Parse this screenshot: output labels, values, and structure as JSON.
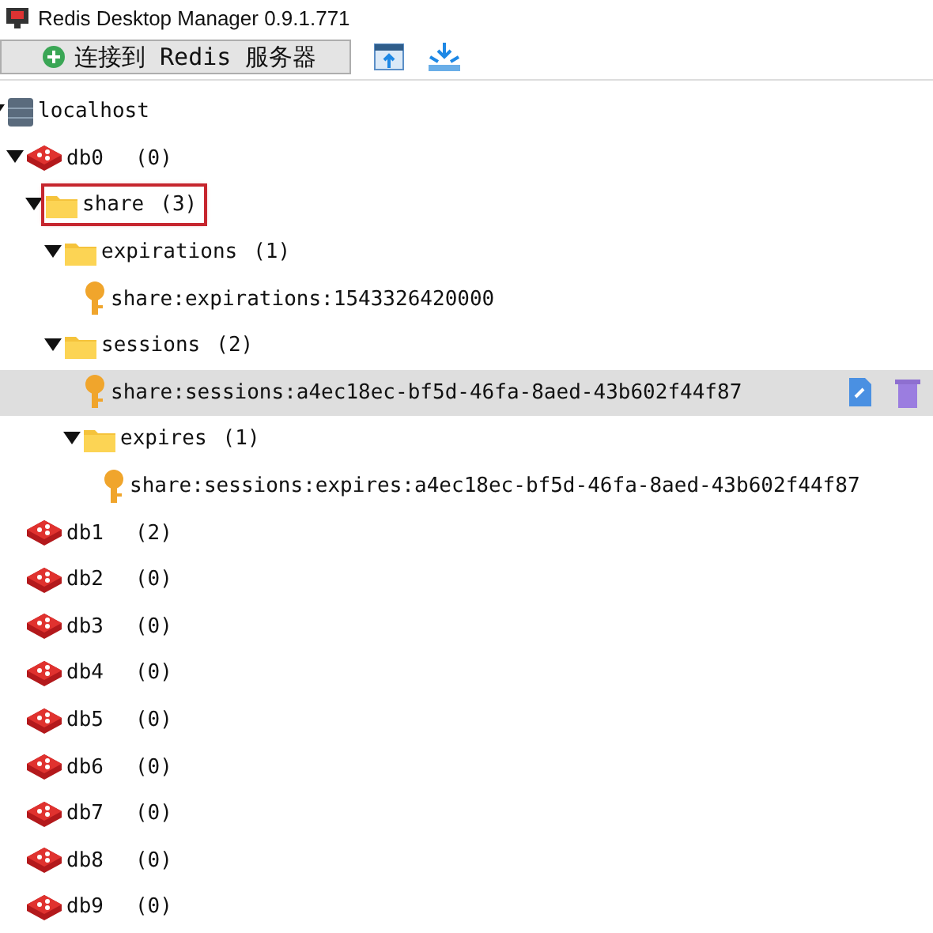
{
  "window": {
    "title": "Redis Desktop Manager 0.9.1.771"
  },
  "toolbar": {
    "connect_button": "连接到 Redis 服务器"
  },
  "tree": [
    {
      "kind": "server",
      "label": "localhost",
      "expanded": true,
      "selected": false,
      "outlined": false,
      "children": [
        {
          "kind": "database",
          "label": "db0",
          "count": "(0)",
          "expanded": true,
          "selected": false,
          "outlined": false,
          "children": [
            {
              "kind": "folder",
              "label": "share",
              "count": "(3)",
              "expanded": true,
              "selected": false,
              "outlined": true,
              "children": [
                {
                  "kind": "folder",
                  "label": "expirations",
                  "count": "(1)",
                  "expanded": true,
                  "selected": false,
                  "outlined": false,
                  "children": [
                    {
                      "kind": "key",
                      "label": "share:expirations:1543326420000",
                      "selected": false,
                      "outlined": false
                    }
                  ]
                },
                {
                  "kind": "folder",
                  "label": "sessions",
                  "count": "(2)",
                  "expanded": true,
                  "selected": false,
                  "outlined": false,
                  "children": [
                    {
                      "kind": "key",
                      "label": "share:sessions:a4ec18ec-bf5d-46fa-8aed-43b602f44f87",
                      "selected": true,
                      "outlined": false
                    },
                    {
                      "kind": "folder",
                      "label": "expires",
                      "count": "(1)",
                      "expanded": true,
                      "selected": false,
                      "outlined": false,
                      "children": [
                        {
                          "kind": "key",
                          "label": "share:sessions:expires:a4ec18ec-bf5d-46fa-8aed-43b602f44f87",
                          "selected": false,
                          "outlined": false
                        }
                      ]
                    }
                  ]
                }
              ]
            }
          ]
        },
        {
          "kind": "database",
          "label": "db1",
          "count": "(2)",
          "selected": false,
          "outlined": false
        },
        {
          "kind": "database",
          "label": "db2",
          "count": "(0)",
          "selected": false,
          "outlined": false
        },
        {
          "kind": "database",
          "label": "db3",
          "count": "(0)",
          "selected": false,
          "outlined": false
        },
        {
          "kind": "database",
          "label": "db4",
          "count": "(0)",
          "selected": false,
          "outlined": false
        },
        {
          "kind": "database",
          "label": "db5",
          "count": "(0)",
          "selected": false,
          "outlined": false
        },
        {
          "kind": "database",
          "label": "db6",
          "count": "(0)",
          "selected": false,
          "outlined": false
        },
        {
          "kind": "database",
          "label": "db7",
          "count": "(0)",
          "selected": false,
          "outlined": false
        },
        {
          "kind": "database",
          "label": "db8",
          "count": "(0)",
          "selected": false,
          "outlined": false
        },
        {
          "kind": "database",
          "label": "db9",
          "count": "(0)",
          "selected": false,
          "outlined": false
        }
      ]
    }
  ]
}
